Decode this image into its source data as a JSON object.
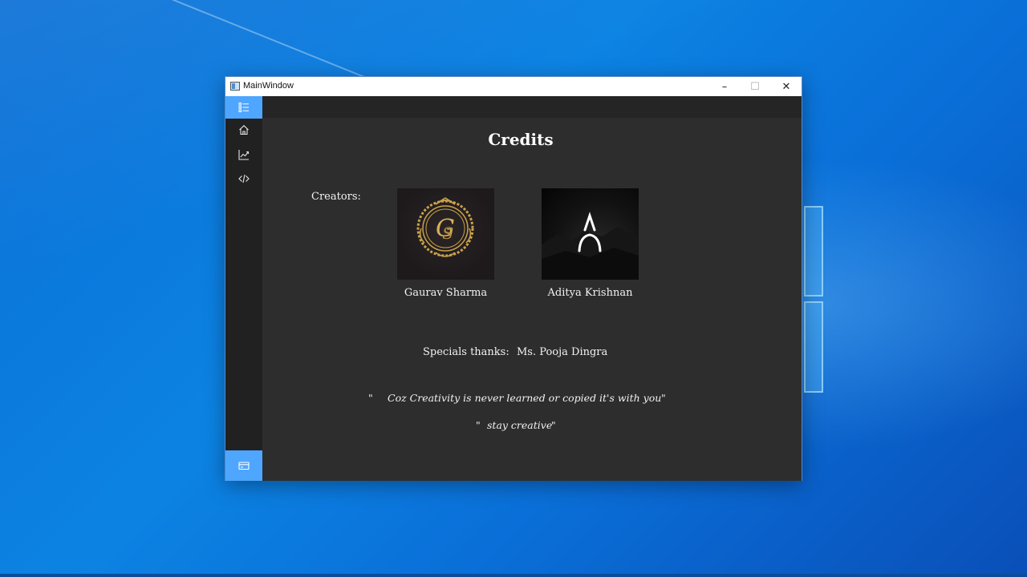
{
  "window": {
    "title": "MainWindow",
    "minimize_glyph": "–",
    "maximize_glyph": "☐",
    "close_glyph": "✕"
  },
  "sidebar": {
    "items": [
      {
        "icon": "list-icon",
        "active": true
      },
      {
        "icon": "home-icon",
        "active": false
      },
      {
        "icon": "chart-icon",
        "active": false
      },
      {
        "icon": "code-icon",
        "active": false
      }
    ],
    "bottom_icon": "card-icon"
  },
  "page": {
    "title": "Credits",
    "creators_label": "Creators:",
    "creators": [
      {
        "name": "Gaurav Sharma",
        "logo": "gold-monogram-logo"
      },
      {
        "name": "Aditya Krishnan",
        "logo": "a-mountain-logo"
      }
    ],
    "thanks_label": "Specials thanks:",
    "thanks_name": "Ms. Pooja Dingra",
    "quote_open": "\"",
    "quote_text": "Coz Creativity is never learned or copied it's with you",
    "quote_close": "\"",
    "tagline_open": "\"",
    "tagline_text": "stay creative",
    "tagline_close": "\""
  },
  "colors": {
    "accent": "#4ea6ff",
    "window_bg": "#2d2d2d",
    "sidebar_bg": "#212121"
  }
}
